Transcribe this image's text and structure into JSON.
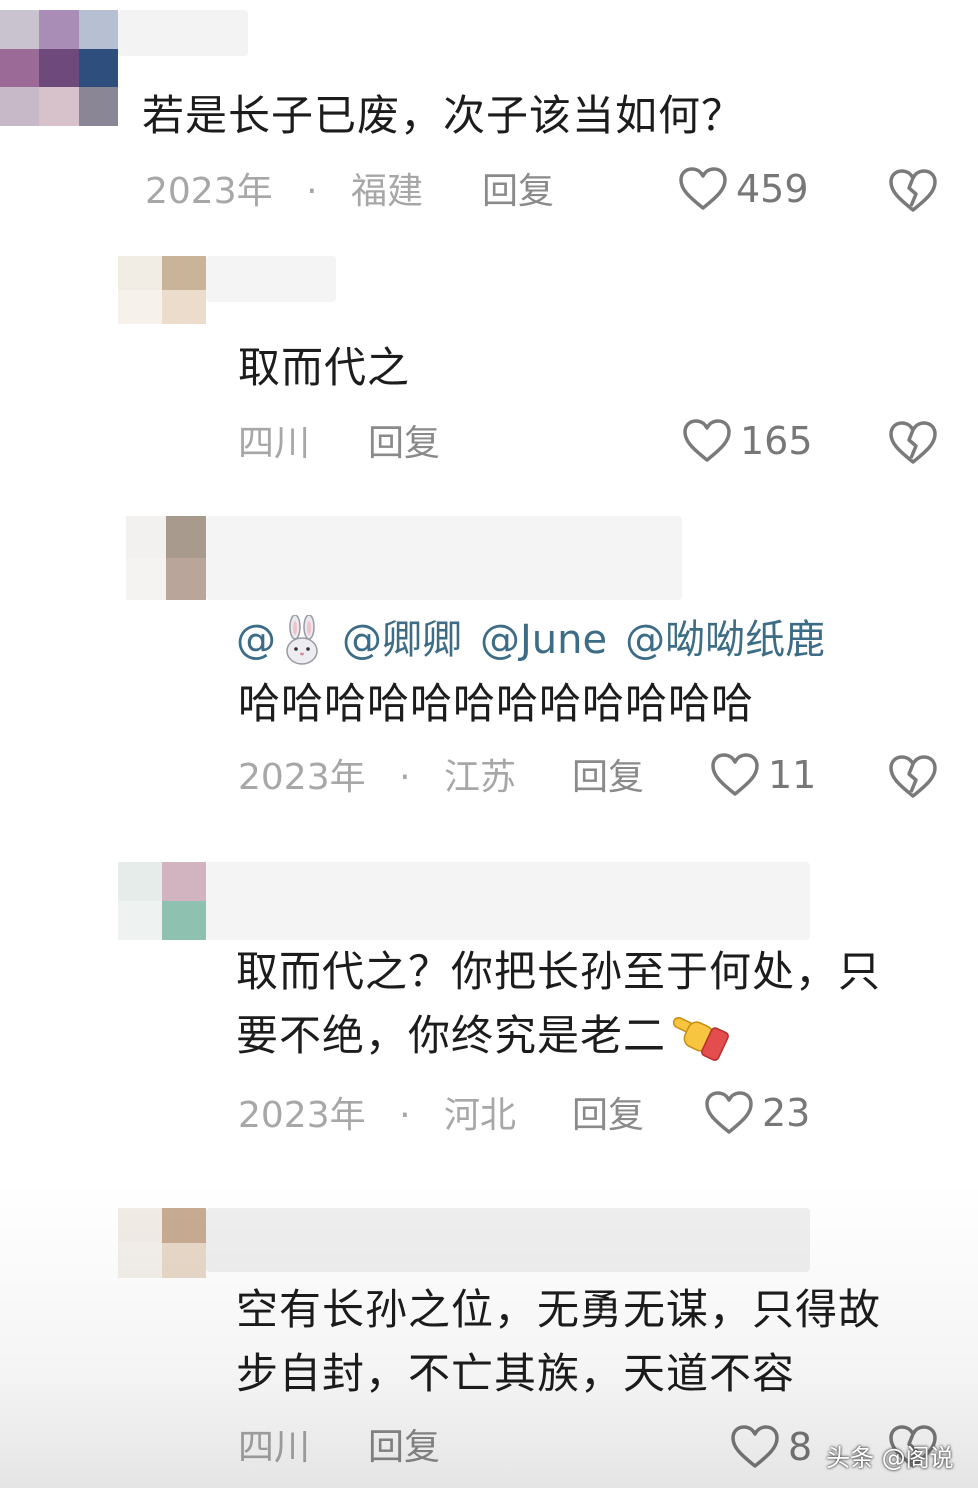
{
  "comments": [
    {
      "text": "若是长子已废，次子该当如何？",
      "time": "2023年",
      "sep": "·",
      "location": "福建",
      "reply_label": "回复",
      "likes": "459"
    },
    {
      "text": "取而代之",
      "location": "四川",
      "reply_label": "回复",
      "likes": "165"
    },
    {
      "mentions": [
        "@",
        "@卿卿",
        "@June",
        "@呦呦纸鹿"
      ],
      "text": "哈哈哈哈哈哈哈哈哈哈哈哈",
      "time": "2023年",
      "sep": "·",
      "location": "江苏",
      "reply_label": "回复",
      "likes": "11"
    },
    {
      "text_line1": "取而代之？你把长孙至于何处，只",
      "text_line2": "要不绝，你终究是老二",
      "time": "2023年",
      "sep": "·",
      "location": "河北",
      "reply_label": "回复",
      "likes": "23"
    },
    {
      "text_line1": "空有长孙之位，无勇无谋，只得故",
      "text_line2": "步自封，不亡其族，天道不容",
      "location": "四川",
      "reply_label": "回复",
      "likes": "8"
    }
  ],
  "watermark": "头条 @阁说",
  "icons": {
    "like": "heart-outline-icon",
    "dislike": "broken-heart-icon",
    "emoji_rabbit": "rabbit-emoji-icon",
    "emoji_pointing": "pointing-hand-emoji-icon"
  }
}
